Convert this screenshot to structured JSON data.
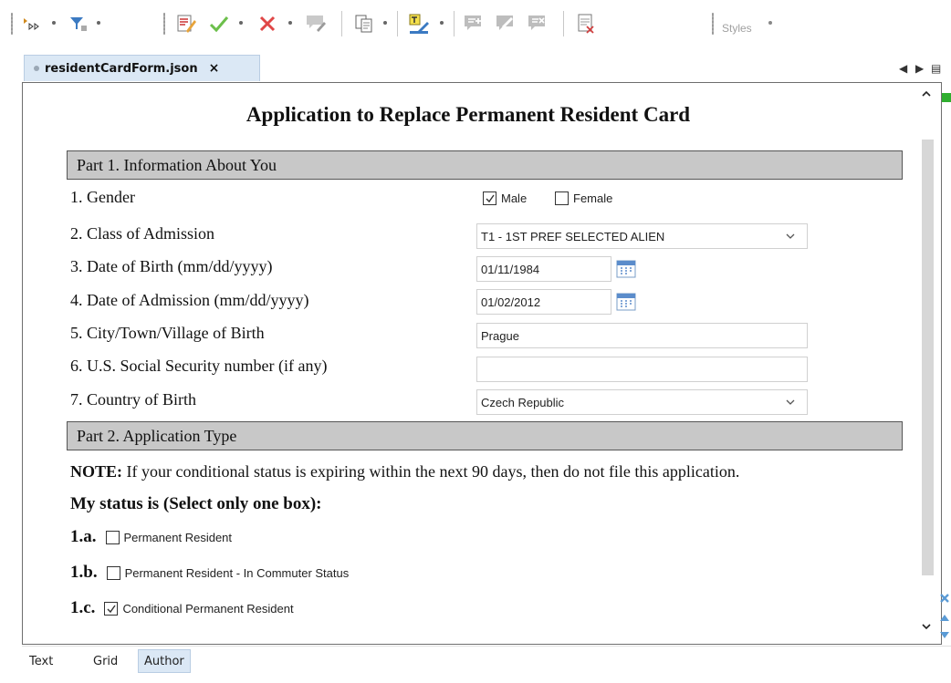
{
  "window": {
    "file_tab": "residentCardForm.json",
    "close_glyph": "×",
    "nav_left": "◀",
    "nav_right": "▶",
    "menu_glyph": "▤"
  },
  "toolbar": {
    "styles_label": "Styles",
    "icons": [
      "track-changes-icon",
      "filter-changes-icon",
      "edit-comment-icon",
      "accept-change-icon",
      "reject-change-icon",
      "comment-icon",
      "copy-icon",
      "highlight-icon",
      "add-comment-icon",
      "edit-note-icon",
      "remove-comment-icon",
      "manage-comments-icon"
    ]
  },
  "form": {
    "title": "Application to Replace Permanent Resident Card",
    "part1_header": "Part 1. Information About You",
    "gender": {
      "label": "1. Gender",
      "options": [
        {
          "label": "Male",
          "checked": true
        },
        {
          "label": "Female",
          "checked": false
        }
      ]
    },
    "class_of_admission": {
      "label": "2. Class of Admission",
      "value": "T1 - 1ST PREF SELECTED ALIEN"
    },
    "date_of_birth": {
      "label": "3. Date of Birth  (mm/dd/yyyy)",
      "value": "01/11/1984"
    },
    "date_of_admission": {
      "label": "4. Date of Admission (mm/dd/yyyy)",
      "value": "01/02/2012"
    },
    "city_of_birth": {
      "label": "5. City/Town/Village of Birth",
      "value": "Prague"
    },
    "ssn": {
      "label": "6. U.S. Social Security number (if any)",
      "value": ""
    },
    "country_of_birth": {
      "label": "7. Country of Birth",
      "value": "Czech Republic"
    },
    "part2_header": "Part 2. Application Type",
    "note_prefix": "NOTE:",
    "note_text": " If your conditional status is expiring within the next 90 days, then do not file this application.",
    "status_heading": "My status is (Select only one box):",
    "status_options": [
      {
        "num": "1.a.",
        "label": "Permanent Resident",
        "checked": false
      },
      {
        "num": "1.b.",
        "label": "Permanent Resident - In Commuter Status",
        "checked": false
      },
      {
        "num": "1.c.",
        "label": "Conditional Permanent Resident",
        "checked": true
      }
    ]
  },
  "mode_tabs": [
    {
      "label": "Text",
      "active": false
    },
    {
      "label": "Grid",
      "active": false
    },
    {
      "label": "Author",
      "active": true
    }
  ],
  "colors": {
    "accent_tab": "#dbe8f5",
    "section_bg": "#c8c8c8",
    "gutter_green": "#2fae2f",
    "gutter_blue": "#5b9bd5"
  }
}
